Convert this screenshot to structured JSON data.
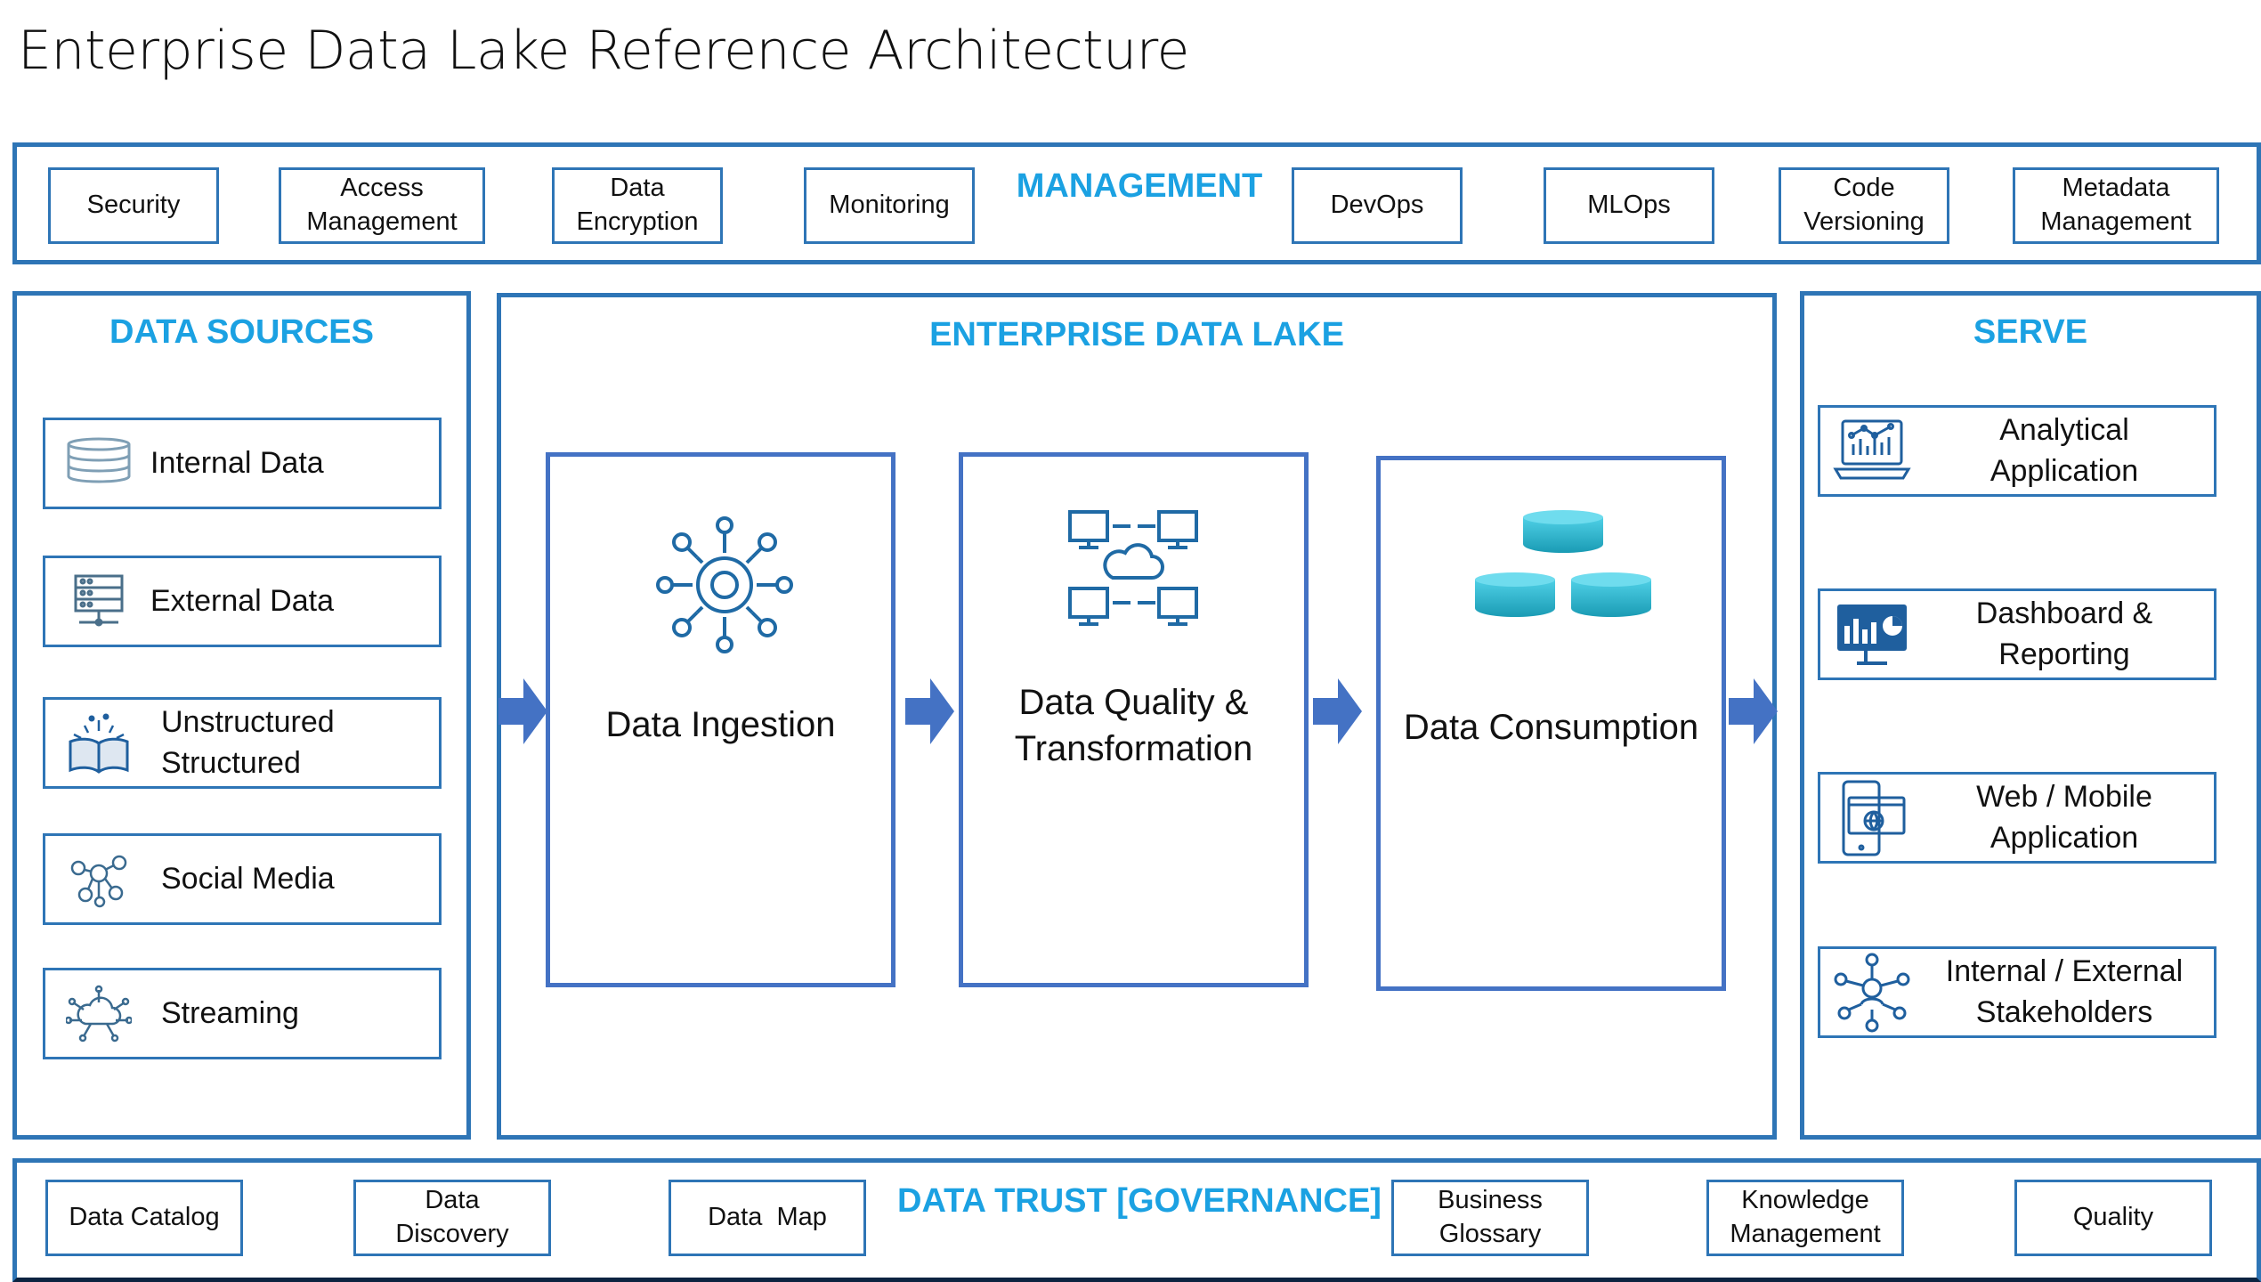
{
  "title": "Enterprise Data Lake Reference Architecture",
  "management": {
    "heading": "MANAGEMENT",
    "items": [
      "Security",
      "Access\nManagement",
      "Data\nEncryption",
      "Monitoring",
      "DevOps",
      "MLOps",
      "Code\nVersioning",
      "Metadata\nManagement"
    ]
  },
  "data_sources": {
    "heading": "DATA SOURCES",
    "items": [
      {
        "label": "Internal Data",
        "icon": "database-icon"
      },
      {
        "label": "External Data",
        "icon": "server-icon"
      },
      {
        "label": "Unstructured\nStructured",
        "icon": "open-book-icon"
      },
      {
        "label": "Social Media",
        "icon": "social-network-icon"
      },
      {
        "label": "Streaming",
        "icon": "cloud-network-icon"
      }
    ]
  },
  "lake": {
    "heading": "ENTERPRISE DATA LAKE",
    "stages": [
      {
        "label": "Data Ingestion",
        "icon": "gear-network-icon"
      },
      {
        "label": "Data Quality &\nTransformation",
        "icon": "cloud-computers-icon"
      },
      {
        "label": "Data Consumption",
        "icon": "data-stacks-icon"
      }
    ]
  },
  "serve": {
    "heading": "SERVE",
    "items": [
      {
        "label": "Analytical\nApplication",
        "icon": "laptop-chart-icon"
      },
      {
        "label": "Dashboard &\nReporting",
        "icon": "monitor-dashboard-icon"
      },
      {
        "label": "Web / Mobile\nApplication",
        "icon": "mobile-web-icon"
      },
      {
        "label": "Internal / External\nStakeholders",
        "icon": "people-network-icon"
      }
    ]
  },
  "governance": {
    "heading": "DATA TRUST [GOVERNANCE]",
    "items": [
      "Data Catalog",
      "Data\nDiscovery",
      "Data  Map",
      "Business\nGlossary",
      "Knowledge\nManagement",
      "Quality"
    ]
  },
  "colors": {
    "border": "#2e75b6",
    "heading": "#1ba1e2",
    "stage_border": "#4472c4",
    "arrow": "#4472c4",
    "cylinder": "#2bb5cc"
  }
}
